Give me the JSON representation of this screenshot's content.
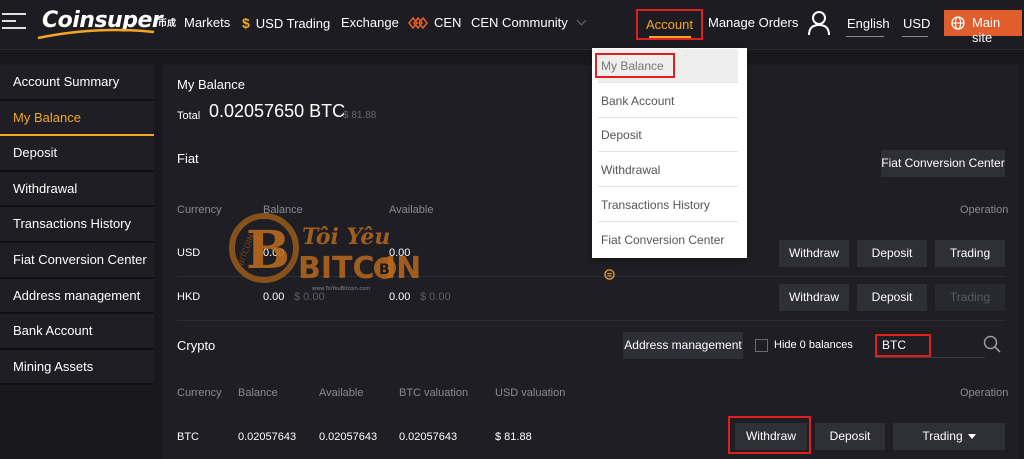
{
  "header": {
    "logo_text": "Coinsuper",
    "logo_sub": "币成",
    "nav": {
      "markets": "Markets",
      "usd_trading": "USD Trading",
      "usd_symbol": "$",
      "exchange": "Exchange",
      "cen": "CEN",
      "cen_community": "CEN Community",
      "account": "Account",
      "manage_orders": "Manage Orders",
      "language": "English",
      "currency": "USD",
      "main_site": "Main site"
    },
    "accent_color": "#f5a623",
    "main_site_color": "#e05d2e"
  },
  "sidebar": {
    "items": [
      {
        "label": "Account Summary"
      },
      {
        "label": "My Balance"
      },
      {
        "label": "Deposit"
      },
      {
        "label": "Withdrawal"
      },
      {
        "label": "Transactions History"
      },
      {
        "label": "Fiat Conversion Center"
      },
      {
        "label": "Address management"
      },
      {
        "label": "Bank Account"
      },
      {
        "label": "Mining Assets"
      }
    ],
    "active_index": 1
  },
  "main": {
    "title": "My Balance",
    "total_label": "Total",
    "total_value": "0.02057650 BTC",
    "total_usd": "$ 81.88",
    "fiat": {
      "label": "Fiat",
      "conversion_button": "Fiat Conversion Center",
      "columns": [
        "Currency",
        "Balance",
        "Available",
        "Operation"
      ],
      "rows": [
        {
          "currency": "USD",
          "balance": "0.00",
          "balance_usd": "",
          "available": "0.00",
          "available_usd": "",
          "withdraw": "Withdraw",
          "deposit": "Deposit",
          "trading": "Trading",
          "trading_enabled": true
        },
        {
          "currency": "HKD",
          "balance": "0.00",
          "balance_usd": "$ 0.00",
          "available": "0.00",
          "available_usd": "$ 0.00",
          "withdraw": "Withdraw",
          "deposit": "Deposit",
          "trading": "Trading",
          "trading_enabled": false
        }
      ]
    },
    "crypto": {
      "label": "Crypto",
      "address_button": "Address management",
      "hide_zero_label": "Hide 0 balances",
      "hide_zero_checked": false,
      "search_value": "BTC",
      "columns": [
        "Currency",
        "Balance",
        "Available",
        "BTC valuation",
        "USD valuation",
        "Operation"
      ],
      "rows": [
        {
          "currency": "BTC",
          "balance": "0.02057643",
          "available": "0.02057643",
          "btc_valuation": "0.02057643",
          "usd_valuation": "$ 81.88",
          "withdraw": "Withdraw",
          "deposit": "Deposit",
          "trading": "Trading"
        }
      ]
    }
  },
  "account_dropdown": {
    "items": [
      {
        "label": "My Balance"
      },
      {
        "label": "Bank Account"
      },
      {
        "label": "Deposit"
      },
      {
        "label": "Withdrawal"
      },
      {
        "label": "Transactions History"
      },
      {
        "label": "Fiat Conversion Center"
      }
    ]
  },
  "watermark": {
    "line1": "Tôi Yêu",
    "line2": "BITC   IN",
    "ring_text": "BITCOIN",
    "url": "www.ToiYeuBitcoin.com"
  },
  "icons": {
    "menu": "hamburger-icon",
    "cen": "cen-logo-icon",
    "user": "user-icon",
    "globe": "globe-icon",
    "search": "search-icon",
    "coin": "coin-icon"
  }
}
